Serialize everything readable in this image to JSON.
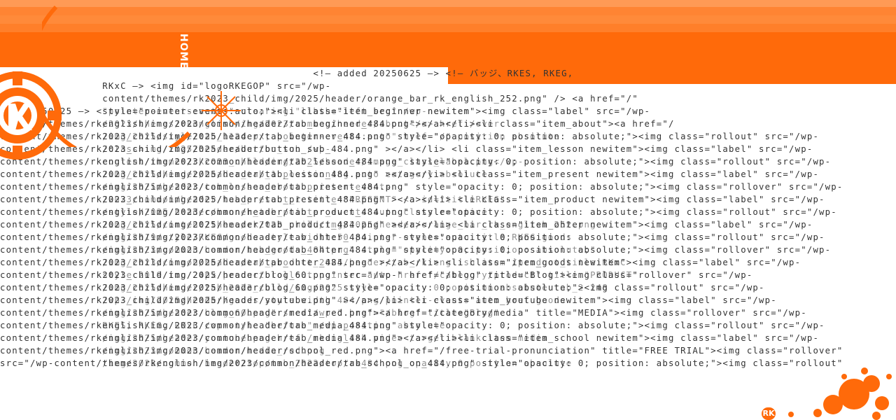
{
  "header": {
    "home_label": "HOME",
    "brand_color": "#ff6a0a",
    "logo_icon": "rk-gear-logo-icon",
    "spark_icon": "spark-icon",
    "mini_logo_label": "RK"
  },
  "source_lines": [
    "                                                    <!– added 20250625 –> <!– バッジ、RKES, RKEG,",
    "                 RKxC –> <img id=\"logoRKEGOP\" src=\"/wp-",
    "                 content/themes/rk2023_child/img/2025/header/orange_bar_rk_english_252.png\" /> <a href=\"/\"",
    "<!– 20250625 –> <style=\"pointer-events:auto;\"><li class=\"item_beginner newitem\"><img class=\"label\" src=\"/wp-",
    "content/themes/rkenglish/img/2023/common/header/tab_beginner_484.png\"></a></li><li class=\"item_about\"><a href=\"/",
    "content/themes/rk2023_child/img/2025/header/tab_beginner_484.png\" style=\"opacity: 0; position: absolute;\"><img class=\"rollout\" src=\"/wp-",
    "content/themes/rk2023_child/img/2025/header/button_sub_484.png\" ></a></li> <li class=\"item_lesson newitem\"><img class=\"label\" src=\"/wp-",
    "content/themes/rkenglish/img/2023/common/header/tab_lesson_484.png\" style=\"opacity: 0; position: absolute;\"><img class=\"rollout\" src=\"/wp-",
    "content/themes/rk2023_child/img/2025/header/tab_lesson_484.png\" ></a></li> <li class=\"item_present newitem\"><img class=\"label\" src=\"/wp-",
    "content/themes/rkenglish/img/2023/common/header/tab_present_484.png\" style=\"opacity: 0; position: absolute;\"><img class=\"rollover\" src=\"/wp-",
    "content/themes/rk2023_child/img/2025/header/tab_present_484.png\" ></a></li> <li class=\"item_product newitem\"><img class=\"label\" src=\"/wp-",
    "content/themes/rkenglish/img/2023/common/header/tab_product_484.png\" style=\"opacity: 0; position: absolute;\"><img class=\"rollout\" src=\"/wp-",
    "content/themes/rk2023_child/img/2025/header/tab_product_484.png\" ></a></li> <li class=\"item_ohter newitem\"><img class=\"label\" src=\"/wp-",
    "content/themes/rkenglish/img/2023/common/header/tab_ohter_484.png\" style=\"opacity: 0; position: absolute;\"><img class=\"rollout\" src=\"/wp-",
    "content/themes/rkenglish/img/2023/common/header/tab_ohter_484.png\" style=\"opacity: 0; position: absolute;\"><img class=\"rollover\" src=\"/wp-",
    "content/themes/rk2023_child/img/2025/header/tab_ohter_484.png\" ></a></li> <li class=\"item_goods newitem\"><img class=\"label\" src=\"/wp-",
    "content/themes/rk2023_child/img/2025/header/blog_60.png\" src=\"/wp-\" href=\"/blog\" title=\"Blog\"><img class=\"rollover\" src=\"/wp-",
    "content/themes/rk2023_child/img/2025/header/blog_60.png\" style=\"opacity: 0; position: absolute;\"><img class=\"rollout\" src=\"/wp-",
    "content/themes/rk2023_child/img/2025/header/youtube.png\" ></a></li> <li class=\"item_youtube newitem\"><img class=\"label\" src=\"/wp-",
    "content/themes/rkenglish/img/2023/common/header/media_red.png\"><a href=\"/category/media\" title=\"MEDIA\"><img class=\"rollover\" src=\"/wp-",
    "content/themes/rkenglish/img/2023/common/header/tab_media_484.png\" style=\"opacity: 0; position: absolute;\"><img class=\"rollout\" src=\"/wp-",
    "content/themes/rkenglish/img/2023/common/header/tab_media_484.png\"></a></li><li class=\"item_school newitem\"><img class=\"label\" src=\"/wp-",
    "content/themes/rkenglish/img/2023/common/header/school_red.png\"><a href=\"/free-trial-pronunciation\" title=\"FREE TRIAL\"><img class=\"rollover\"",
    "src=\"/wp-content/themes/rkenglish/img/2023/common/header/tab_school_on_484.png\" style=\"opacity: 0; position: absolute;\"><img class=\"rollout\""
  ],
  "ghost_lines": [
    "",
    "",
    "",
    "                 \"pointer-events:auto;\" clearing \"libthe-left src\" /wp-newitem",
    "                 /2023/themes/rkenglish/img/2023/common/header/about</a> href /over",
    "                 /img/2025/style/tab_1124 px; pointer-events:auto\" href \"/\" position absolute",
    "                 /class=img/2025/header/button_sub_/wp-",
    "                 content/themes/rk2023_child/img/2025/header/image_class_label.png</wp-",
    "                 /img/2025/header/header_tab_1 positioning auto category absolute",
    "                 /img/2025/header/tab_lesson_about pointer-events",
    "                 /2023/common/header/tab_present_1 title=\"PRESENT\" <a id=\"titleRKEG\"",
    "                 /style/2025/header/banner_tab_pointer_events auto class relative",
    "                 /img/2025/content/theme/rk2023_child/img/2025/header/orange_bar_rk_english_252.png",
    "                 /img/2019/style/RKEG/goods style width:50 pointer-events:auto title RKEG goods",
    "                 /img/2023/common/header/tab_goods_484.png\" style=\"opacity: 0; position: absolute;\"",
    "                 /img/2023/common/header/tab_product_2025/header/tab_rk english item /product_title RKxC",
    "                 style 2019 top 24px product rollout pointer auto href \"/category/product\" title \"PRODUCT\"",
    "                 /img/2025/header/tab_2023_child/img/2025 style opacity 0 position absolute tab_2 248",
    "                 /wp-/img/2025/header/goods style width 484 png pointer-events auto href goods",
    "                 /img/2025/header/blog_60.png\" src=\"/wp-\" href=\"/blog\" title=\"Blog\"",
    "                 RKES, RKEG, RKxC /wp-style \"before\" /wp-position absolute",
    "                 /img/2025/header/youtube.png href /rkenglish video target blank item media",
    "                 /img/2023/common/header/media_red.png",
    "                 /img/2023/common/header/top/tab_2022/top/rk484 png opacity 0 position absolute"
  ]
}
